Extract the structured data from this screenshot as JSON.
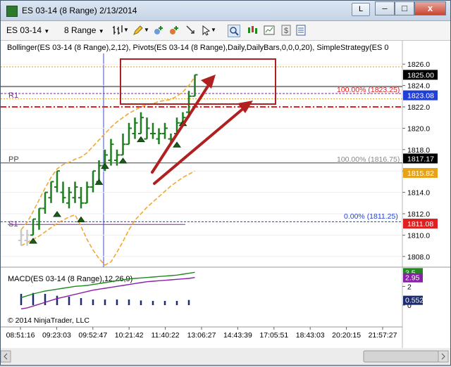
{
  "window": {
    "title": "ES 03-14 (8 Range)  2/13/2014",
    "title_button_label": "L",
    "minimize": "–",
    "maximize": "□",
    "close": "x"
  },
  "toolbar": {
    "instrument": "ES 03-14",
    "period": "8 Range"
  },
  "price_panel": {
    "indicator_label": "Bollinger(ES 03-14 (8 Range),2,12), Pivots(ES 03-14 (8 Range),Daily,DailyBars,0,0,0,20), SimpleStrategy(ES 0",
    "pivot_labels": {
      "r1": "R1",
      "pp": "PP",
      "s1": "S1"
    },
    "level_labels": {
      "upper": "100.00% (1823.25)",
      "middle": "100.00% (1816.75)",
      "lower": "0.00% (1811.25)"
    },
    "axis_ticks": [
      "1826.0",
      "1824.0",
      "1822.0",
      "1820.0",
      "1818.0",
      "1816.0",
      "1814.0",
      "1812.0",
      "1810.0",
      "1808.0"
    ],
    "price_tags": [
      {
        "label": "1825.00",
        "color": "#000000"
      },
      {
        "label": "1823.08",
        "color": "#1f3fd6"
      },
      {
        "label": "1817.17",
        "color": "#000000"
      },
      {
        "label": "1815.82",
        "color": "#e6a319"
      },
      {
        "label": "1811.08",
        "color": "#e02020"
      }
    ]
  },
  "macd_panel": {
    "label": "MACD(ES 03-14 (8 Range),12,26,9)",
    "axis_ticks": [
      "2",
      "0"
    ],
    "tags": [
      {
        "label": "3.5",
        "color": "#1e8a1e"
      },
      {
        "label": "2.95",
        "color": "#8a1fa8"
      },
      {
        "label": "0.552",
        "color": "#1a2b6e"
      }
    ],
    "copyright": "© 2014 NinjaTrader, LLC"
  },
  "time_axis": [
    "08:51:16",
    "09:23:03",
    "09:52:47",
    "10:21:42",
    "11:40:22",
    "13:06:27",
    "14:43:39",
    "17:05:51",
    "18:43:03",
    "20:20:15",
    "21:57:27"
  ],
  "colors": {
    "bar_up": "#1e7d1e",
    "bollinger": "#f2a830",
    "pivot_r1": "#e02020",
    "pivot_s1": "#1f3fd6",
    "annotation": "#b02020"
  },
  "chart_data": {
    "type": "ohlc",
    "y_range": [
      1807,
      1827
    ],
    "bars": [
      {
        "x": 0,
        "open": 1809.5,
        "high": 1810.5,
        "low": 1809.0,
        "close": 1810.0
      },
      {
        "x": 1,
        "open": 1809.5,
        "high": 1810.5,
        "low": 1809.0,
        "close": 1810.0
      },
      {
        "x": 2,
        "open": 1810.0,
        "high": 1811.5,
        "low": 1810.0,
        "close": 1811.5
      },
      {
        "x": 3,
        "open": 1811.0,
        "high": 1812.5,
        "low": 1810.5,
        "close": 1812.5
      },
      {
        "x": 4,
        "open": 1812.5,
        "high": 1814.0,
        "low": 1812.0,
        "close": 1814.0
      },
      {
        "x": 5,
        "open": 1813.5,
        "high": 1815.0,
        "low": 1813.0,
        "close": 1815.0
      },
      {
        "x": 6,
        "open": 1814.5,
        "high": 1816.0,
        "low": 1814.0,
        "close": 1816.0
      },
      {
        "x": 7,
        "open": 1814.0,
        "high": 1815.0,
        "low": 1813.0,
        "close": 1813.5
      },
      {
        "x": 8,
        "open": 1813.0,
        "high": 1814.5,
        "low": 1812.5,
        "close": 1814.0
      },
      {
        "x": 9,
        "open": 1813.5,
        "high": 1815.0,
        "low": 1813.0,
        "close": 1814.5
      },
      {
        "x": 10,
        "open": 1813.5,
        "high": 1814.5,
        "low": 1812.5,
        "close": 1813.0
      },
      {
        "x": 11,
        "open": 1813.0,
        "high": 1815.0,
        "low": 1813.0,
        "close": 1814.5
      },
      {
        "x": 12,
        "open": 1814.5,
        "high": 1816.0,
        "low": 1814.0,
        "close": 1816.0
      },
      {
        "x": 13,
        "open": 1815.0,
        "high": 1817.0,
        "low": 1815.0,
        "close": 1816.5
      },
      {
        "x": 14,
        "open": 1816.5,
        "high": 1818.0,
        "low": 1816.0,
        "close": 1817.5
      },
      {
        "x": 15,
        "open": 1817.0,
        "high": 1819.0,
        "low": 1816.5,
        "close": 1818.5
      },
      {
        "x": 16,
        "open": 1817.0,
        "high": 1818.0,
        "low": 1816.5,
        "close": 1817.5
      },
      {
        "x": 17,
        "open": 1817.5,
        "high": 1819.5,
        "low": 1817.5,
        "close": 1818.5
      },
      {
        "x": 18,
        "open": 1818.5,
        "high": 1820.5,
        "low": 1818.5,
        "close": 1820.0
      },
      {
        "x": 19,
        "open": 1819.5,
        "high": 1821.0,
        "low": 1819.0,
        "close": 1820.5
      },
      {
        "x": 20,
        "open": 1819.5,
        "high": 1821.5,
        "low": 1819.5,
        "close": 1821.0
      },
      {
        "x": 21,
        "open": 1819.0,
        "high": 1821.0,
        "low": 1819.0,
        "close": 1820.0
      },
      {
        "x": 22,
        "open": 1819.5,
        "high": 1820.5,
        "low": 1819.0,
        "close": 1819.5
      },
      {
        "x": 23,
        "open": 1819.0,
        "high": 1820.0,
        "low": 1818.5,
        "close": 1819.5
      },
      {
        "x": 24,
        "open": 1819.5,
        "high": 1820.5,
        "low": 1819.0,
        "close": 1820.0
      },
      {
        "x": 25,
        "open": 1819.0,
        "high": 1819.5,
        "low": 1818.5,
        "close": 1819.0
      },
      {
        "x": 26,
        "open": 1819.5,
        "high": 1821.0,
        "low": 1819.5,
        "close": 1820.5
      },
      {
        "x": 27,
        "open": 1820.5,
        "high": 1821.5,
        "low": 1820.5,
        "close": 1821.0
      },
      {
        "x": 28,
        "open": 1821.5,
        "high": 1823.5,
        "low": 1821.0,
        "close": 1823.0
      },
      {
        "x": 29,
        "open": 1823.0,
        "high": 1825.0,
        "low": 1823.0,
        "close": 1825.0
      }
    ],
    "signals": [
      {
        "x": 2,
        "y": 1809.5
      },
      {
        "x": 6,
        "y": 1812.0
      },
      {
        "x": 10,
        "y": 1811.5
      },
      {
        "x": 13,
        "y": 1815.0
      },
      {
        "x": 14,
        "y": 1816.5
      },
      {
        "x": 17,
        "y": 1817.0
      },
      {
        "x": 20,
        "y": 1819.0
      },
      {
        "x": 26,
        "y": 1818.5
      },
      {
        "x": 27,
        "y": 1820.5
      }
    ],
    "bollinger_upper": [
      1810.5,
      1811.2,
      1812.2,
      1813.3,
      1814.4,
      1815.4,
      1816.2,
      1816.6,
      1816.8,
      1817.1,
      1817.3,
      1817.7,
      1818.3,
      1818.9,
      1819.5,
      1820.1,
      1820.6,
      1821.0,
      1821.4,
      1821.7,
      1822.0,
      1822.2,
      1822.3,
      1822.5,
      1822.6,
      1822.7,
      1823.0,
      1823.4,
      1824.0,
      1824.8
    ],
    "bollinger_lower": [
      1809.0,
      1809.3,
      1809.6,
      1809.9,
      1810.3,
      1810.7,
      1811.1,
      1811.4,
      1811.7,
      1811.9,
      1810.8,
      1809.6,
      1808.6,
      1807.8,
      1807.2,
      1807.5,
      1808.4,
      1809.4,
      1810.5,
      1811.4,
      1812.0,
      1812.6,
      1813.1,
      1813.6,
      1814.1,
      1814.6,
      1815.0,
      1815.4,
      1815.7,
      1816.0
    ],
    "pivot_levels": {
      "r1": 1823.25,
      "pp": 1816.75,
      "s1": 1811.25,
      "extra_dotted": 1825.75,
      "extra_dashed": 1822.0
    },
    "macd": {
      "y_range": [
        -0.6,
        3.6
      ],
      "macd_line": [
        0.8,
        1.0,
        1.2,
        1.35,
        1.5,
        1.6,
        1.7,
        1.8,
        1.9,
        2.0,
        2.05,
        2.1,
        2.2,
        2.3,
        2.4,
        2.5,
        2.6,
        2.7,
        2.8,
        2.85,
        2.9,
        2.95,
        3.0,
        3.05,
        3.1,
        3.15,
        3.2,
        3.3,
        3.4,
        3.5
      ],
      "signal_line": [
        -0.4,
        -0.3,
        -0.1,
        0.1,
        0.3,
        0.5,
        0.7,
        0.85,
        1.0,
        1.15,
        1.3,
        1.45,
        1.6,
        1.7,
        1.8,
        1.9,
        2.0,
        2.1,
        2.2,
        2.3,
        2.4,
        2.5,
        2.55,
        2.6,
        2.65,
        2.7,
        2.75,
        2.8,
        2.85,
        2.95
      ],
      "histogram": [
        1.2,
        1.3,
        1.3,
        1.25,
        1.2,
        1.1,
        1.0,
        0.95,
        0.9,
        0.85,
        0.75,
        0.65,
        0.6,
        0.6,
        0.6,
        0.6,
        0.6,
        0.6,
        0.6,
        0.55,
        0.5,
        0.45,
        0.45,
        0.45,
        0.45,
        0.45,
        0.45,
        0.5,
        0.55,
        0.55
      ]
    }
  }
}
